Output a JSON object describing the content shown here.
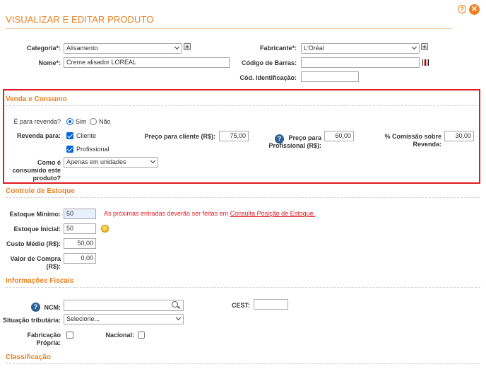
{
  "header": {
    "title": "VISUALIZAR E EDITAR PRODUTO",
    "help_glyph": "?",
    "close_glyph": "✕"
  },
  "produto": {
    "categoria_label": "Categoria*:",
    "categoria_value": "Alisamento",
    "fabricante_label": "Fabricante*:",
    "fabricante_value": "L'Oréal",
    "nome_label": "Nome*:",
    "nome_value": "Creme alisador LOREAL",
    "codigo_barras_label": "Código de Barras:",
    "codigo_barras_value": "",
    "cod_identificacao_label": "Cód. Identificação:",
    "cod_identificacao_value": "",
    "plus_glyph": "+"
  },
  "venda": {
    "section_title": "Venda e Consumo",
    "revenda_label": "É para revenda?",
    "sim_label": "Sim",
    "nao_label": "Não",
    "revenda_para_label": "Revenda para:",
    "cliente_label": "Cliente",
    "profissional_label": "Profissional",
    "preco_cliente_label": "Preço para cliente (R$):",
    "preco_cliente_value": "75,00",
    "preco_profissional_label_1": "Preço para",
    "preco_profissional_label_2": "Profissional (R$):",
    "preco_profissional_value": "60,00",
    "comissao_label_1": "% Comissão sobre",
    "comissao_label_2": "Revenda:",
    "comissao_value": "30,00",
    "consumo_label_1": "Como é",
    "consumo_label_2": "consumido este",
    "consumo_label_3": "produto?",
    "consumo_value": "Apenas em unidades",
    "help_glyph": "?"
  },
  "estoque": {
    "section_title": "Controle de Estoque",
    "minimo_label": "Estoque Mínimo:",
    "minimo_value": "50",
    "warning_text": "As próximas entradas deverão ser feitas em ",
    "warning_link": "Consulta Posição de Estoque.",
    "inicial_label": "Estoque Inicial:",
    "inicial_value": "50",
    "custo_label": "Custo Médio (R$):",
    "custo_value": "50,00",
    "valor_compra_label_1": "Valor de Compra",
    "valor_compra_label_2": "(R$):",
    "valor_compra_value": "0,00"
  },
  "fiscais": {
    "section_title": "Informações Fiscais",
    "ncm_label": "NCM:",
    "ncm_value": "",
    "cest_label": "CEST:",
    "cest_value": "",
    "situacao_label": "Situação tributária:",
    "situacao_value": "Selecione...",
    "fabricacao_label_1": "Fabricação",
    "fabricacao_label_2": "Própria:",
    "nacional_label": "Nacional:",
    "help_glyph": "?"
  },
  "classificacao": {
    "section_title": "Classificação"
  },
  "colors": {
    "accent": "#e8801f",
    "highlight": "#e11a22",
    "checkbox": "#0b66d6",
    "help_icon": "#2c5f93"
  }
}
